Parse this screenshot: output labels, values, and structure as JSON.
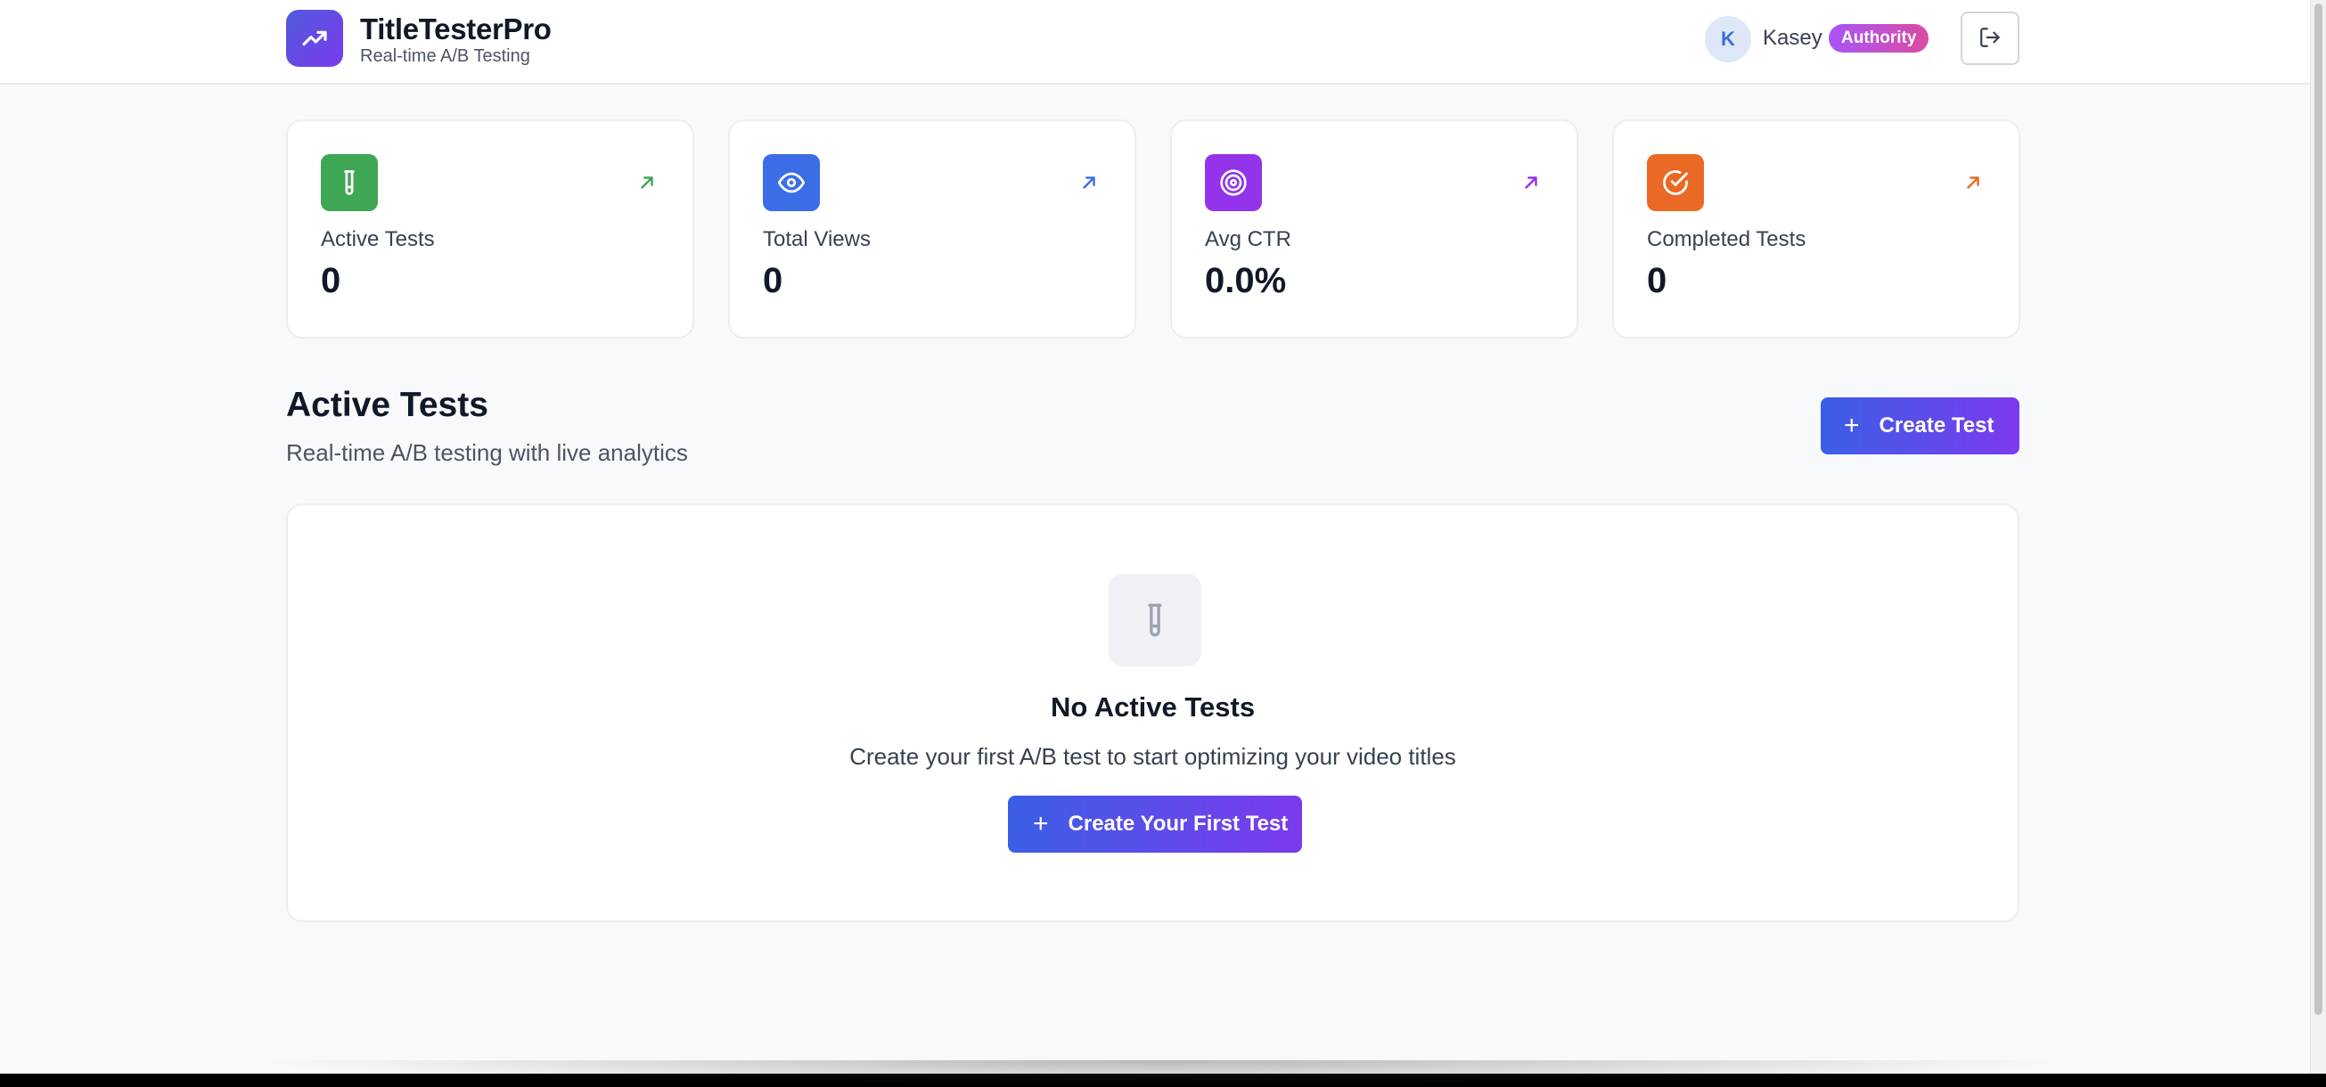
{
  "header": {
    "app_name": "TitleTesterPro",
    "app_subtitle": "Real-time A/B Testing",
    "user": {
      "avatar_initial": "K",
      "name": "Kasey",
      "role_badge": "Authority"
    }
  },
  "stats": [
    {
      "label": "Active Tests",
      "value": "0",
      "icon": "test-tube-icon",
      "color": "#3fa653"
    },
    {
      "label": "Total Views",
      "value": "0",
      "icon": "eye-icon",
      "color": "#3b6ee6"
    },
    {
      "label": "Avg CTR",
      "value": "0.0%",
      "icon": "target-icon",
      "color": "#9333ea"
    },
    {
      "label": "Completed Tests",
      "value": "0",
      "icon": "check-circle-icon",
      "color": "#ea6a25"
    }
  ],
  "section": {
    "title": "Active Tests",
    "subtitle": "Real-time A/B testing with live analytics",
    "create_button": "Create Test"
  },
  "empty_state": {
    "title": "No Active Tests",
    "description": "Create your first A/B test to start optimizing your video titles",
    "button": "Create Your First Test"
  },
  "colors": {
    "accent_gradient_start": "#3b5fe6",
    "accent_gradient_end": "#7c3aed",
    "badge_gradient_start": "#a855f7",
    "badge_gradient_end": "#db4ba3"
  }
}
